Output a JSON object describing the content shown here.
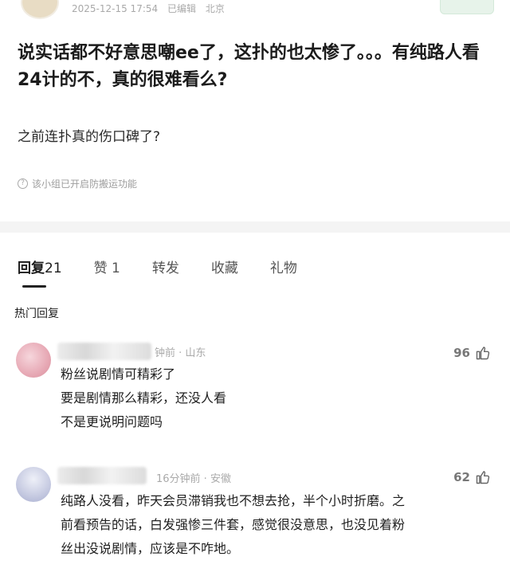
{
  "post": {
    "meta_date": "2025-12-15 17:54",
    "meta_edited": "已编辑",
    "meta_location": "北京",
    "title": "说实话都不好意思嘲ee了，这扑的也太惨了。。。有纯路人看24计的不，真的很难看么?",
    "body": "之前连扑真的伤口碑了?",
    "notice": "该小组已开启防搬运功能"
  },
  "tabs": [
    {
      "label": "回复",
      "count": "21"
    },
    {
      "label": "赞",
      "count": "1"
    },
    {
      "label": "转发",
      "count": ""
    },
    {
      "label": "收藏",
      "count": ""
    },
    {
      "label": "礼物",
      "count": ""
    }
  ],
  "hot_replies_label": "热门回复",
  "comments": [
    {
      "meta": "钟前 · 山东",
      "likes": "96",
      "lines": [
        "粉丝说剧情可精彩了",
        "要是剧情那么精彩，还没人看",
        "不是更说明问题吗"
      ]
    },
    {
      "meta": "16分钟前 · 安徽",
      "likes": "62",
      "lines": [
        "纯路人没看，昨天会员滞销我也不想去抢，半个小时折磨。之",
        "前看预告的话，白发强惨三件套，感觉很没意思，也没见着粉",
        "丝出没说剧情，应该是不咋地。"
      ]
    }
  ],
  "colors": {
    "accent_underline": "#222222",
    "meta_gray": "#a9a9a9"
  }
}
